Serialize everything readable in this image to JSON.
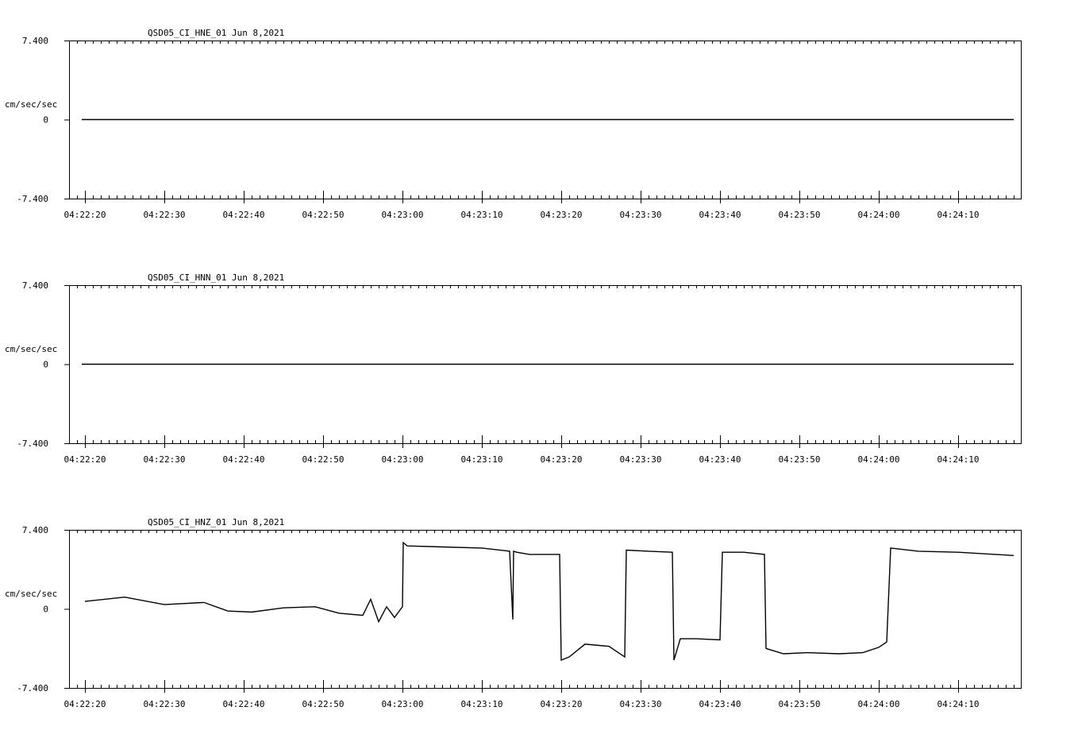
{
  "chart_data": [
    {
      "type": "line",
      "title": "QSD05_CI_HNE_01  Jun 8,2021",
      "ylabel": "cm/sec/sec",
      "ylim": [
        -7.4,
        7.4
      ],
      "ytick_labels": [
        "7.400",
        "0",
        "-7.400"
      ],
      "xlim": [
        "04:22:19",
        "04:24:17"
      ],
      "x_tick_labels": [
        "04:22:20",
        "04:22:30",
        "04:22:40",
        "04:22:50",
        "04:23:00",
        "04:23:10",
        "04:23:20",
        "04:23:30",
        "04:23:40",
        "04:23:50",
        "04:24:00",
        "04:24:10"
      ],
      "series": [
        {
          "x": [
            "04:22:19",
            "04:24:17"
          ],
          "y": [
            0,
            0
          ]
        }
      ],
      "grid": false
    },
    {
      "type": "line",
      "title": "QSD05_CI_HNN_01  Jun 8,2021",
      "ylabel": "cm/sec/sec",
      "ylim": [
        -7.4,
        7.4
      ],
      "ytick_labels": [
        "7.400",
        "0",
        "-7.400"
      ],
      "xlim": [
        "04:22:19",
        "04:24:17"
      ],
      "x_tick_labels": [
        "04:22:20",
        "04:22:30",
        "04:22:40",
        "04:22:50",
        "04:23:00",
        "04:23:10",
        "04:23:20",
        "04:23:30",
        "04:23:40",
        "04:23:50",
        "04:24:00",
        "04:24:10"
      ],
      "series": [
        {
          "x": [
            "04:22:19",
            "04:24:17"
          ],
          "y": [
            0,
            0
          ]
        }
      ],
      "grid": false
    },
    {
      "type": "line",
      "title": "QSD05_CI_HNZ_01  Jun 8,2021",
      "ylabel": "cm/sec/sec",
      "ylim": [
        -7.4,
        7.4
      ],
      "ytick_labels": [
        "7.400",
        "0",
        "-7.400"
      ],
      "xlim": [
        "04:22:19",
        "04:24:17"
      ],
      "x_tick_labels": [
        "04:22:20",
        "04:22:30",
        "04:22:40",
        "04:22:50",
        "04:23:00",
        "04:23:10",
        "04:23:20",
        "04:23:30",
        "04:23:40",
        "04:23:50",
        "04:24:00",
        "04:24:10"
      ],
      "series": [
        {
          "x": [
            "04:22:20",
            "04:22:25",
            "04:22:30",
            "04:22:35",
            "04:22:38",
            "04:22:41",
            "04:22:45",
            "04:22:49",
            "04:22:52",
            "04:22:55",
            "04:22:56",
            "04:22:57",
            "04:22:58",
            "04:22:59",
            "04:23:00",
            "04:23:00.1",
            "04:23:00.6",
            "04:23:05",
            "04:23:10",
            "04:23:13.5",
            "04:23:13.9",
            "04:23:14.0",
            "04:23:14.4",
            "04:23:16",
            "04:23:19.8",
            "04:23:20",
            "04:23:21",
            "04:23:23",
            "04:23:26",
            "04:23:28",
            "04:23:28.2",
            "04:23:31",
            "04:23:34",
            "04:23:34.2",
            "04:23:35",
            "04:23:37",
            "04:23:40",
            "04:23:40.3",
            "04:23:43",
            "04:23:45.6",
            "04:23:45.8",
            "04:23:48",
            "04:23:51",
            "04:23:55",
            "04:23:58",
            "04:24:00",
            "04:24:01",
            "04:24:01.5",
            "04:24:05",
            "04:24:10",
            "04:24:17"
          ],
          "y": [
            0.7,
            1.1,
            0.4,
            0.6,
            -0.2,
            -0.3,
            0.1,
            0.2,
            -0.4,
            -0.6,
            0.9,
            -1.2,
            0.2,
            -0.8,
            0.2,
            6.2,
            5.9,
            5.8,
            5.7,
            5.4,
            -1.0,
            5.4,
            5.3,
            5.1,
            5.1,
            -4.8,
            -4.5,
            -3.3,
            -3.5,
            -4.5,
            5.5,
            5.4,
            5.3,
            -4.8,
            -2.8,
            -2.8,
            -2.9,
            5.3,
            5.3,
            5.1,
            -3.7,
            -4.2,
            -4.1,
            -4.2,
            -4.1,
            -3.6,
            -3.1,
            5.7,
            5.4,
            5.3,
            5.0
          ]
        }
      ],
      "grid": false
    }
  ]
}
